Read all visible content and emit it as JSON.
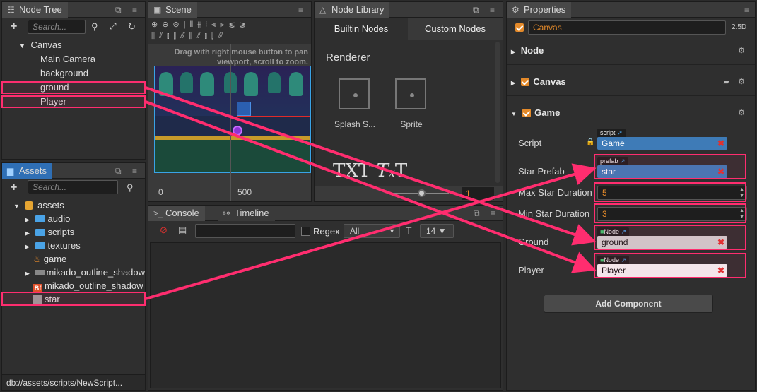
{
  "node_tree": {
    "tab_label": "Node Tree",
    "search_placeholder": "Search...",
    "root": "Canvas",
    "children": [
      "Main Camera",
      "background",
      "ground",
      "Player"
    ]
  },
  "assets": {
    "tab_label": "Assets",
    "search_placeholder": "Search...",
    "root": "assets",
    "items": [
      "audio",
      "scripts",
      "textures",
      "game",
      "mikado_outline_shadow",
      "mikado_outline_shadow",
      "star"
    ],
    "status_path": "db://assets/scripts/NewScript..."
  },
  "scene": {
    "tab_label": "Scene",
    "hint": "Drag with right mouse button to pan viewport, scroll to zoom.",
    "ruler_0": "0",
    "ruler_500": "500"
  },
  "node_library": {
    "tab_label": "Node Library",
    "tab_builtin": "Builtin Nodes",
    "tab_custom": "Custom Nodes",
    "section": "Renderer",
    "item1": "Splash S...",
    "item2": "Sprite",
    "zoom_value": "1"
  },
  "console": {
    "tab_label": "Console",
    "tab_timeline": "Timeline",
    "regex_label": "Regex",
    "filter_value": "All",
    "font_size": "14 ▼"
  },
  "properties": {
    "tab_label": "Properties",
    "node_name": "Canvas",
    "mode": "2.5D",
    "sections": {
      "node": "Node",
      "canvas": "Canvas",
      "game": "Game"
    },
    "fields": {
      "script_label": "Script",
      "script_tag": "script",
      "script_value": "Game",
      "star_prefab_label": "Star Prefab",
      "star_prefab_tag": "prefab",
      "star_prefab_value": "star",
      "max_star_label": "Max Star Duration",
      "max_star_value": "5",
      "min_star_label": "Min Star Duration",
      "min_star_value": "3",
      "ground_label": "Ground",
      "ground_tag": "Node",
      "ground_value": "ground",
      "player_label": "Player",
      "player_tag": "Node",
      "player_value": "Player"
    },
    "add_component": "Add Component"
  },
  "colors": {
    "accent": "#ff2d6f",
    "selection_blue": "#3e7bb7",
    "orange": "#e48a2a"
  }
}
